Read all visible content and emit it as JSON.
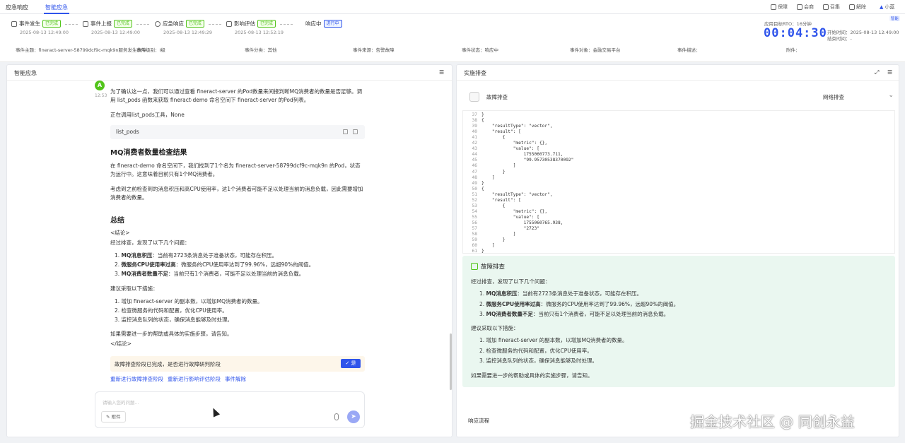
{
  "topnav": {
    "tabs": [
      {
        "label": "应急响应"
      },
      {
        "label": "智能应急"
      }
    ],
    "actions": [
      {
        "label": "保障",
        "icon": "shield-icon"
      },
      {
        "label": "会商",
        "icon": "chat-icon"
      },
      {
        "label": "召集",
        "icon": "megaphone-icon"
      },
      {
        "label": "解除",
        "icon": "unlock-icon"
      }
    ],
    "user": "小蓝"
  },
  "header": {
    "steps": [
      {
        "label": "事件发生",
        "status": "已完成",
        "time": "2025-08-13 12:49:00"
      },
      {
        "label": "事件上报",
        "status": "已完成",
        "time": "2025-08-13 12:49:00"
      },
      {
        "label": "应急响应",
        "status": "已完成",
        "time": "2025-08-13 12:49:29"
      },
      {
        "label": "影响评估",
        "status": "已完成",
        "time": "2025-08-13 12:52:19"
      },
      {
        "label": "响应中",
        "status": "进行中",
        "time": ""
      }
    ],
    "rto_label": "应用目标RTO：16分钟",
    "timer": "00:04:30",
    "start_label": "开始时间：2025-08-13 12:49:00",
    "end_label": "结束时间：-",
    "small_tag": "智能",
    "info": [
      {
        "label": "事件主题：fineract-server-58799dcf9c-mqk9n服务发生故障"
      },
      {
        "label": "事件级别：I级"
      },
      {
        "label": "事件分类：其他"
      },
      {
        "label": "事件来源：告警故障"
      },
      {
        "label": "事件状态：响应中"
      },
      {
        "label": "事件对象：金融交易平台"
      },
      {
        "label": "事件描述："
      },
      {
        "label": "附件："
      }
    ]
  },
  "left": {
    "title": "智能应急",
    "avatar_time": "12:53",
    "intro": "为了确认这一点，我们可以通过查看 fineract-server 的Pod数量来间接判断MQ消费者的数量是否足够。调用 list_pods 函数来获取 fineract-demo 命名空间下 fineract-server 的Pod列表。",
    "calling": "正在调用list_pods工具，None",
    "code": "list_pods",
    "h_check": "MQ消费者数量检查结果",
    "check_p1": "在 fineract-demo 命名空间下，我们找到了1个名为 fineract-server-58799dcf9c-mqk9n 的Pod，状态为运行中。这意味着目前只有1个MQ消费者。",
    "check_p2": "考虑到之前检查到的消息积压和高CPU使用率，这1个消费者可能不足以处理当前的消息负载，因此需要增加消费者的数量。",
    "h_summary": "总结",
    "conclusion_open": "<结论>",
    "summary_lead": "经过排查，发现了以下几个问题：",
    "issues": [
      {
        "title": "MQ消息积压",
        "text": "：当前有2723条消息处于准备状态，可能存在积压。"
      },
      {
        "title": "微服务CPU使用率过高",
        "text": "：微服务的CPU使用率达到了99.96%，远超90%的阈值。"
      },
      {
        "title": "MQ消费者数量不足",
        "text": "：当前只有1个消费者，可能不足以处理当前的消息负载。"
      }
    ],
    "measures_lead": "建议采取以下措施：",
    "measures": [
      "增加 fineract-server 的副本数，以增加MQ消费者的数量。",
      "检查微服务的代码和配置，优化CPU使用率。",
      "监控消息队列的状态，确保消息能够及时处理。"
    ],
    "help": "如果需要进一步的帮助或具体的实施步骤，请告知。",
    "conclusion_close": "</结论>",
    "notice": "故障排查阶段已完成，是否进行故障研判阶段",
    "yes_label": "✓ 是",
    "links": [
      "重新进行故障排查阶段",
      "重新进行影响评估阶段",
      "事件解除"
    ],
    "input_placeholder": "请输入您的问题...",
    "attach_label": "附件"
  },
  "right": {
    "title": "实施排查",
    "sub_title": "故障排查",
    "select_value": "网络排查",
    "code_lines": [
      {
        "n": "37",
        "t": "}"
      },
      {
        "n": "38",
        "t": "{"
      },
      {
        "n": "39",
        "t": "    \"resultType\": \"vector\","
      },
      {
        "n": "40",
        "t": "    \"result\": ["
      },
      {
        "n": "41",
        "t": "        {"
      },
      {
        "n": "42",
        "t": "            \"metric\": {},"
      },
      {
        "n": "43",
        "t": "            \"value\": ["
      },
      {
        "n": "44",
        "t": "                1755060773.711,"
      },
      {
        "n": "45",
        "t": "                \"99.95730538370092\""
      },
      {
        "n": "46",
        "t": "            ]"
      },
      {
        "n": "47",
        "t": "        }"
      },
      {
        "n": "48",
        "t": "    ]"
      },
      {
        "n": "49",
        "t": "}"
      },
      {
        "n": "50",
        "t": "{"
      },
      {
        "n": "51",
        "t": "    \"resultType\": \"vector\","
      },
      {
        "n": "52",
        "t": "    \"result\": ["
      },
      {
        "n": "53",
        "t": "        {"
      },
      {
        "n": "54",
        "t": "            \"metric\": {},"
      },
      {
        "n": "55",
        "t": "            \"value\": ["
      },
      {
        "n": "56",
        "t": "                1755060765.938,"
      },
      {
        "n": "57",
        "t": "                \"2723\""
      },
      {
        "n": "58",
        "t": "            ]"
      },
      {
        "n": "59",
        "t": "        }"
      },
      {
        "n": "60",
        "t": "    ]"
      },
      {
        "n": "61",
        "t": "}"
      }
    ],
    "result_title": "故障排查",
    "result_lead": "经过排查，发现了以下几个问题：",
    "result_issues": [
      {
        "title": "MQ消息积压",
        "text": "：当前有2723条消息处于准备状态，可能存在积压。"
      },
      {
        "title": "微服务CPU使用率过高",
        "text": "：微服务的CPU使用率达到了99.96%，远超90%的阈值。"
      },
      {
        "title": "MQ消费者数量不足",
        "text": "：当前只有1个消费者，可能不足以处理当前的消息负载。"
      }
    ],
    "result_measures_lead": "建议采取以下措施：",
    "result_measures": [
      "增加 fineract-server 的副本数，以增加MQ消费者的数量。",
      "检查微服务的代码和配置，优化CPU使用率。",
      "监控消息队列的状态，确保消息能够及时处理。"
    ],
    "result_help": "如果需要进一步的帮助或具体的实施步骤，请告知。",
    "flow_label": "响应流程"
  },
  "watermark": "掘金技术社区 @ 同创永益"
}
